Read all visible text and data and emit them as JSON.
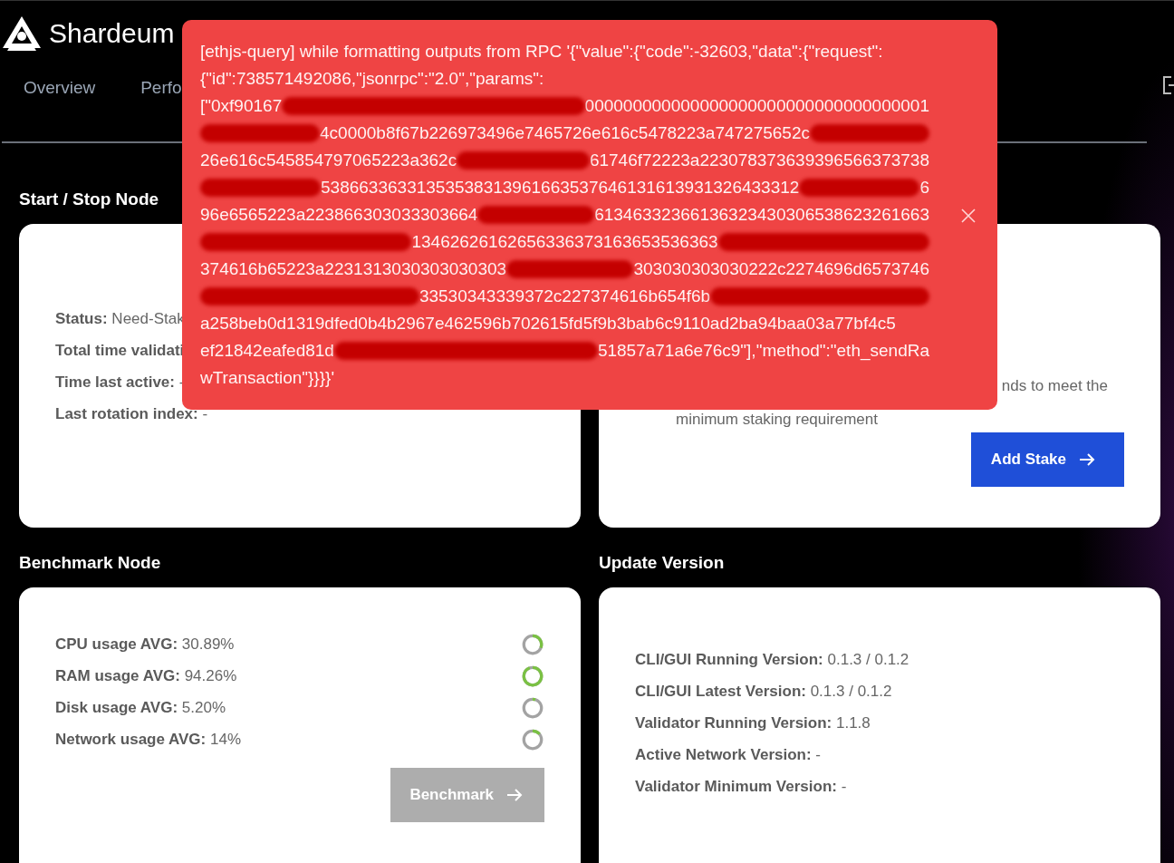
{
  "header": {
    "logo_text": "Shardeum"
  },
  "tabs": [
    {
      "label": "Overview",
      "selected": false
    },
    {
      "label": "Perfo",
      "selected": false
    }
  ],
  "start_stop": {
    "title": "Start / Stop Node",
    "rows": [
      "**Status:** Need-Stak",
      "**Total time validati**",
      "**Time last active:** -",
      "**Last rotation index:** -"
    ]
  },
  "stake": {
    "description": [
      "nds to meet the",
      "minimum staking requirement"
    ],
    "button": {
      "label": "Add Stake",
      "disabled": false
    }
  },
  "benchmark": {
    "title": "Benchmark Node",
    "rows": [
      {
        "text": "**CPU usage AVG:** 30.89%",
        "level": 0.31
      },
      {
        "text": "**RAM usage AVG:** 94.26%",
        "level": 0.94
      },
      {
        "text": "**Disk usage AVG:** 5.20%",
        "level": 0.05
      },
      {
        "text": "**Network usage AVG:** 14%",
        "level": 0.14
      }
    ],
    "button": {
      "label": "Benchmark",
      "disabled": true
    }
  },
  "update": {
    "title": "Update Version",
    "rows": [
      "**CLI/GUI Running Version:** 0.1.3 / 0.1.2",
      "**CLI/GUI Latest Version:** 0.1.3 / 0.1.2",
      "**Validator Running Version:** 1.1.8",
      "**Active Network Version:** -",
      "**Validator Minimum Version:** -"
    ]
  },
  "error_toast": {
    "lines": [
      [
        {
          "kind": "text",
          "text": "[ethjs-query] while formatting outputs from RPC '{\"value\":{\"code\":-32603,\"data\":{\"request\":"
        }
      ],
      [
        {
          "kind": "text",
          "text": "{\"id\":738571492086,\"jsonrpc\":\"2.0\",\"params\":"
        }
      ],
      [
        {
          "kind": "text",
          "text": "[\"0xf90167"
        },
        {
          "kind": "redacted"
        },
        {
          "kind": "text",
          "text": "000000000000000000000000000000000001"
        }
      ],
      [
        {
          "kind": "redacted"
        },
        {
          "kind": "text",
          "text": "4c0000b8f67b226973496e7465726e616c5478223a747275652c"
        },
        {
          "kind": "redacted"
        }
      ],
      [
        {
          "kind": "text",
          "text": "26e616c545854797065223a362c"
        },
        {
          "kind": "redacted"
        },
        {
          "kind": "text",
          "text": "61746f72223a223078373639396566373738"
        }
      ],
      [
        {
          "kind": "redacted"
        },
        {
          "kind": "text",
          "text": "53866336331353538313961663537646131613931326433312"
        },
        {
          "kind": "redacted"
        },
        {
          "kind": "text",
          "text": "6"
        }
      ],
      [
        {
          "kind": "text",
          "text": "96e6565223a223866303033303664"
        },
        {
          "kind": "redacted"
        },
        {
          "kind": "text",
          "text": "61346332366136323430306538623261663"
        }
      ],
      [
        {
          "kind": "redacted"
        },
        {
          "kind": "text",
          "text": "13462626162656336373163653536363"
        },
        {
          "kind": "redacted"
        }
      ],
      [
        {
          "kind": "text",
          "text": "374616b65223a2231313030303030303"
        },
        {
          "kind": "redacted"
        },
        {
          "kind": "text",
          "text": "303030303030222c2274696d6573746"
        }
      ],
      [
        {
          "kind": "redacted"
        },
        {
          "kind": "text",
          "text": "33530343339372c227374616b654f6b"
        },
        {
          "kind": "redacted"
        }
      ],
      [
        {
          "kind": "text",
          "text": "a258beb0d1319dfed0b4b2967e462596b702615fd5f9b3bab6c9110ad2ba94baa03a77bf4c5"
        }
      ],
      [
        {
          "kind": "text",
          "text": "ef21842eafed81d"
        },
        {
          "kind": "redacted"
        },
        {
          "kind": "text",
          "text": "51857a71a6e76c9\"],\"method\":\"eth_sendRa"
        }
      ],
      [
        {
          "kind": "text",
          "text": "wTransaction\"}}}}'"
        }
      ]
    ]
  }
}
